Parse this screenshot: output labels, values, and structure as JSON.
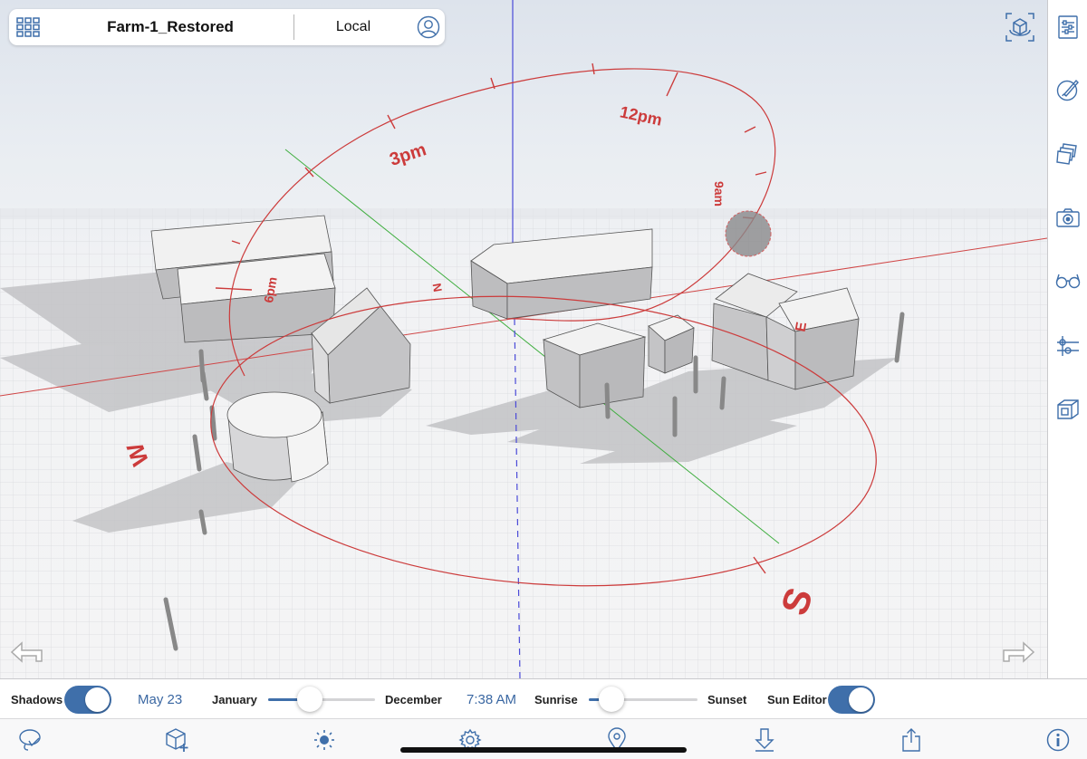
{
  "header": {
    "grid_icon": "grid-icon",
    "model_title": "Farm-1_Restored",
    "location": "Local",
    "profile_icon": "person-icon"
  },
  "viewport": {
    "compass": {
      "north": "N",
      "south": "S",
      "east": "E",
      "west": "W"
    },
    "sun_path_hours": [
      "9am",
      "12pm",
      "3pm",
      "6pm"
    ],
    "axis_colors": {
      "red": "#d04545",
      "green": "#3fae3f",
      "blue": "#4a4ad8"
    },
    "orbit_icon": "orbit-icon",
    "undo_icon": "undo-arrow-icon",
    "redo_icon": "redo-arrow-icon"
  },
  "right_toolbar": [
    {
      "icon": "entity-info-icon"
    },
    {
      "icon": "materials-brush-icon"
    },
    {
      "icon": "layers-icon"
    },
    {
      "icon": "scenes-camera-icon"
    },
    {
      "icon": "display-glasses-icon"
    },
    {
      "icon": "outliner-icon"
    },
    {
      "icon": "components-icon"
    }
  ],
  "sun_bar": {
    "shadows_label": "Shadows",
    "shadows_on": true,
    "date": "May 23",
    "month_start": "January",
    "month_end": "December",
    "month_position": 0.39,
    "time": "7:38 AM",
    "sunrise_label": "Sunrise",
    "sunset_label": "Sunset",
    "time_position": 0.21,
    "sun_editor_label": "Sun Editor",
    "sun_editor_on": true
  },
  "bottom_toolbar": [
    {
      "icon": "lasso-select-icon"
    },
    {
      "icon": "add-component-icon"
    },
    {
      "icon": "sun-icon"
    },
    {
      "icon": "settings-gear-icon"
    },
    {
      "icon": "location-pin-icon"
    },
    {
      "icon": "download-icon"
    },
    {
      "icon": "share-icon"
    },
    {
      "icon": "info-icon"
    }
  ],
  "colors": {
    "accent": "#3f6faa",
    "sunpath": "#cc3b3b"
  }
}
